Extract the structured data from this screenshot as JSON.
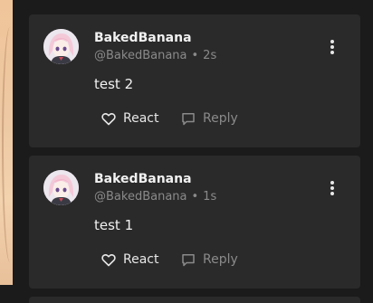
{
  "comments": [
    {
      "author_name": "BakedBanana",
      "handle": "@BakedBanana",
      "separator": "•",
      "time": "2s",
      "text": "test 2",
      "react_label": "React",
      "reply_label": "Reply"
    },
    {
      "author_name": "BakedBanana",
      "handle": "@BakedBanana",
      "separator": "•",
      "time": "1s",
      "text": "test 1",
      "react_label": "React",
      "reply_label": "Reply"
    }
  ],
  "colors": {
    "background": "#1b1b1b",
    "card": "#2a2a2a",
    "primary_text": "#f1f1f1",
    "muted_text": "#8a8a8a"
  },
  "icons": {
    "more": "more-vertical-icon",
    "react": "heart-icon",
    "reply": "comment-bubble-icon"
  }
}
